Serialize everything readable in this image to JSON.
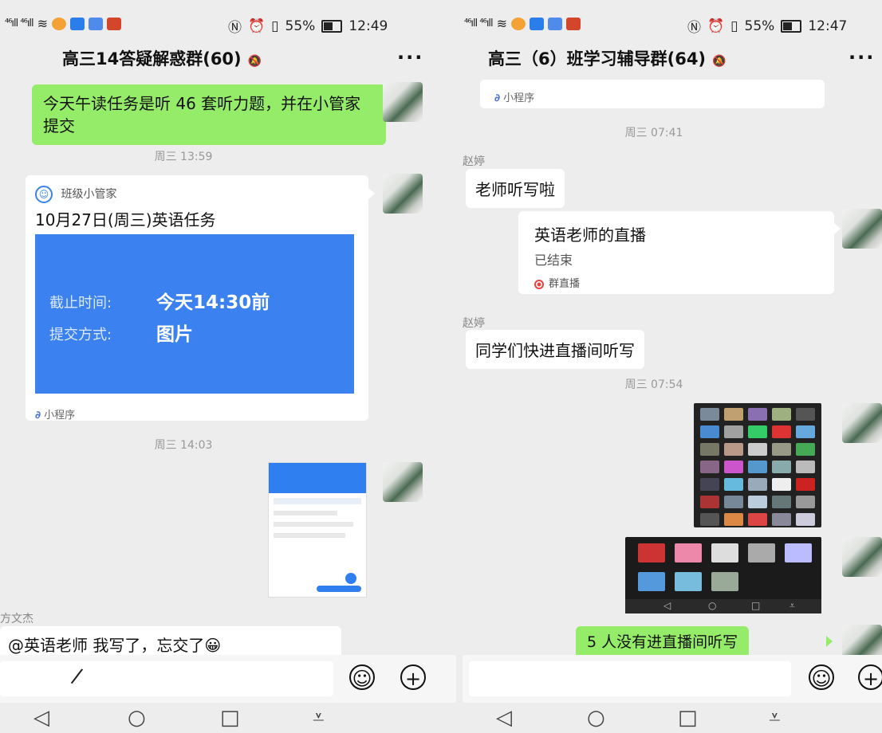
{
  "left": {
    "status": {
      "percent": "55%",
      "time": "12:49"
    },
    "title": "高三14答疑解惑群(60)",
    "more": "···",
    "msg1": "今天午读任务是听 46 套听力题，并在小管家提交",
    "ts1": "周三 13:59",
    "card": {
      "app_name": "班级小管家",
      "task_title": "10月27日(周三)英语任务",
      "deadline_label": "截止时间:",
      "deadline_value": "今天14:30前",
      "method_label": "提交方式:",
      "method_value": "图片",
      "footer": "小程序"
    },
    "ts2": "周三 14:03",
    "sender": "方文杰",
    "msg2": "@英语老师  我写了，忘交了😀"
  },
  "right": {
    "status": {
      "percent": "55%",
      "time": "12:47"
    },
    "title": "高三（6）班学习辅导群(64)",
    "more": "···",
    "top_card_footer": "小程序",
    "ts1": "周三 07:41",
    "sender1": "赵婷",
    "msg1": "老师听写啦",
    "live": {
      "title": "英语老师的直播",
      "status": "已结束",
      "footer": "群直播"
    },
    "sender2": "赵婷",
    "msg2": "同学们快进直播间听写",
    "ts2": "周三 07:54",
    "msg3": "5 人没有进直播间听写"
  },
  "colors": {
    "green_bubble": "#95ec69",
    "card_blue": "#3b82f0",
    "live_red": "#e64340"
  },
  "icons": [
    "emoji-icon",
    "plus-icon",
    "nav-back-icon",
    "nav-home-icon",
    "nav-recent-icon",
    "nav-down-icon",
    "mute-icon",
    "pen-icon"
  ]
}
